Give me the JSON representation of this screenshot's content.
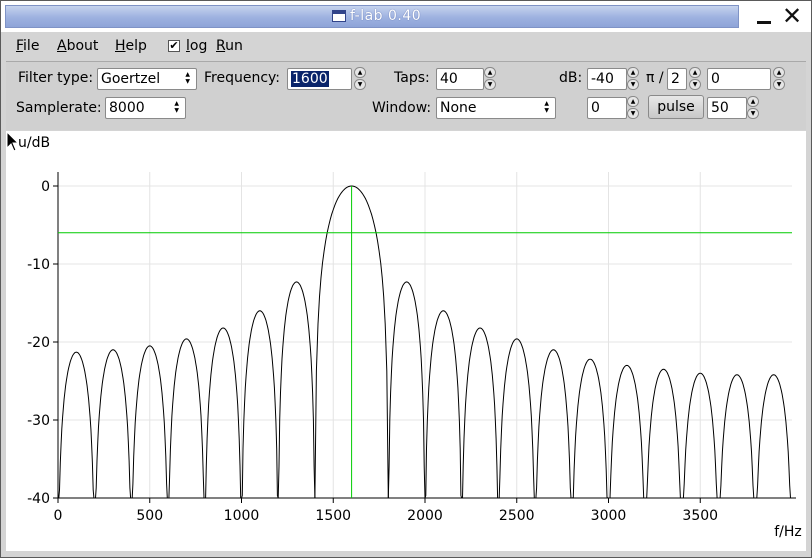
{
  "window": {
    "title": "f-lab 0.40",
    "close_glyph": "✕"
  },
  "menubar": {
    "file": "File",
    "about": "About",
    "help": "Help",
    "log_label": "log",
    "log_checked": true,
    "run": "Run"
  },
  "controls": {
    "filter_type_label": "Filter type:",
    "filter_type_value": "Goertzel",
    "frequency_label": "Frequency:",
    "frequency_value": "1600",
    "taps_label": "Taps:",
    "taps_value": "40",
    "db_label": "dB:",
    "db_value": "-40",
    "pi_label": "π /",
    "pi_divisor": "2",
    "phase_value": "0",
    "samplerate_label": "Samplerate:",
    "samplerate_value": "8000",
    "window_label": "Window:",
    "window_value": "None",
    "offset_value": "0",
    "pulse_label": "pulse",
    "pulse_value": "50"
  },
  "chart_data": {
    "type": "line",
    "ylabel": "u/dB",
    "xlabel": "f/Hz",
    "xlim": [
      0,
      4000
    ],
    "ylim": [
      -40,
      0
    ],
    "x_ticks": [
      0,
      500,
      1000,
      1500,
      2000,
      2500,
      3000,
      3500
    ],
    "y_ticks": [
      0,
      -10,
      -20,
      -30,
      -40
    ],
    "grid": true,
    "series": [
      {
        "color": "#000000",
        "peaks": [
          {
            "x": 100,
            "y": -21.3
          },
          {
            "x": 300,
            "y": -21.0
          },
          {
            "x": 500,
            "y": -20.5
          },
          {
            "x": 700,
            "y": -19.6
          },
          {
            "x": 900,
            "y": -18.2
          },
          {
            "x": 1100,
            "y": -16.0
          },
          {
            "x": 1300,
            "y": -12.3
          },
          {
            "x": 1600,
            "y": 0
          },
          {
            "x": 1900,
            "y": -12.3
          },
          {
            "x": 2100,
            "y": -16.0
          },
          {
            "x": 2300,
            "y": -18.2
          },
          {
            "x": 2500,
            "y": -19.6
          },
          {
            "x": 2700,
            "y": -21.0
          },
          {
            "x": 2900,
            "y": -22.2
          },
          {
            "x": 3100,
            "y": -23.0
          },
          {
            "x": 3300,
            "y": -23.5
          },
          {
            "x": 3500,
            "y": -24.0
          },
          {
            "x": 3700,
            "y": -24.2
          },
          {
            "x": 3900,
            "y": -24.2
          }
        ],
        "nulls": [
          0,
          200,
          400,
          600,
          800,
          1000,
          1200,
          1400,
          1800,
          2000,
          2200,
          2400,
          2600,
          2800,
          3000,
          3200,
          3400,
          3600,
          3800,
          4000
        ]
      }
    ],
    "markers": {
      "vertical_x": 1600,
      "horizontal_y": -6,
      "color": "#00cc00"
    }
  }
}
